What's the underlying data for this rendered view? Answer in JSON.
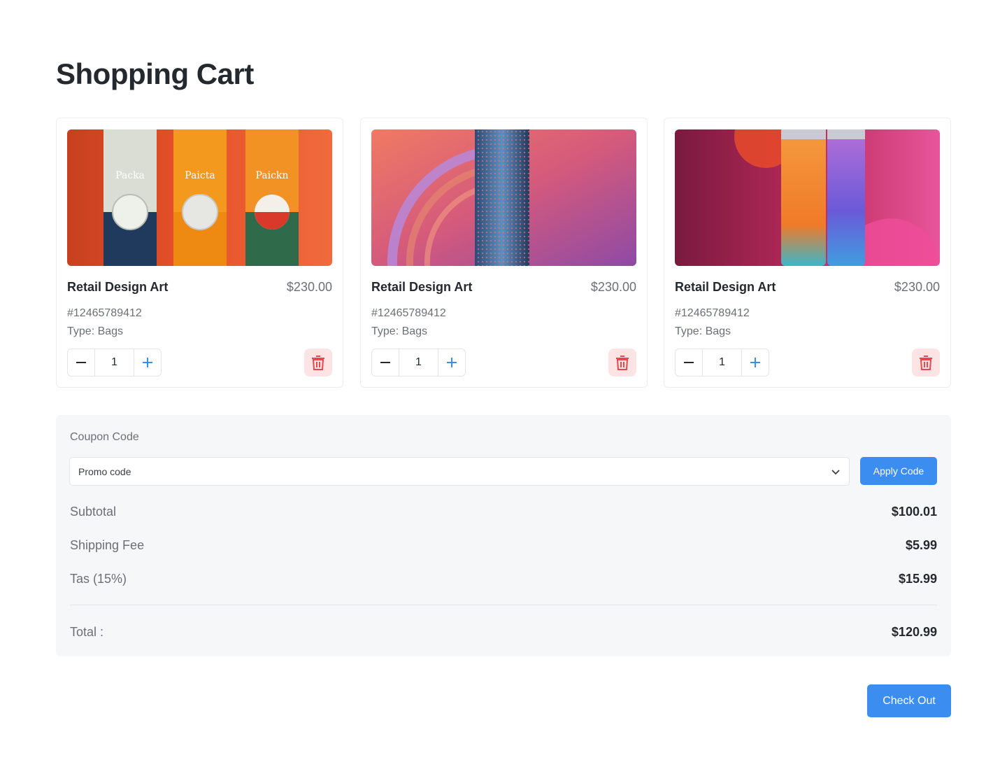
{
  "page": {
    "title": "Shopping Cart"
  },
  "products": [
    {
      "name": "Retail Design Art",
      "price": "$230.00",
      "sku": "#12465789412",
      "type": "Type: Bags",
      "qty": "1",
      "image_text": [
        "Packa",
        "Paicta",
        "Paickn"
      ]
    },
    {
      "name": "Retail Design Art",
      "price": "$230.00",
      "sku": "#12465789412",
      "type": "Type: Bags",
      "qty": "1"
    },
    {
      "name": "Retail Design Art",
      "price": "$230.00",
      "sku": "#12465789412",
      "type": "Type: Bags",
      "qty": "1"
    }
  ],
  "coupon": {
    "label": "Coupon Code",
    "selected": "Promo code",
    "apply_label": "Apply Code"
  },
  "summary": {
    "subtotal_label": "Subtotal",
    "subtotal": "$100.01",
    "shipping_label": "Shipping Fee",
    "shipping": "$5.99",
    "tax_label": "Tas (15%)",
    "tax": "$15.99",
    "total_label": "Total :",
    "total": "$120.99"
  },
  "checkout_label": "Check Out",
  "colors": {
    "accent": "#3b8ef0",
    "danger": "#e5484d",
    "danger_bg": "#fde4e4",
    "panel": "#f6f7f8"
  }
}
